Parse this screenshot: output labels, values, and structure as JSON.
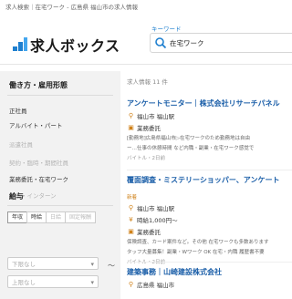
{
  "page_title": "求人検索｜在宅ワーク - 広島県 福山市の求人情報",
  "logo": {
    "text": "求人ボックス"
  },
  "search": {
    "label": "キーワード",
    "value": "在宅ワーク"
  },
  "sidebar": {
    "work_style_title": "働き方・雇用形態",
    "employment_types": [
      {
        "label": "正社員",
        "state": "enabled"
      },
      {
        "label": "アルバイト・パート",
        "state": "enabled"
      },
      {
        "label": "派遣社員",
        "state": "disabled"
      },
      {
        "label": "契約・臨時・期間社員",
        "state": "disabled"
      },
      {
        "label": "業務委託・在宅ワーク",
        "state": "enabled"
      },
      {
        "label": "新卒・インターン",
        "state": "disabled"
      }
    ],
    "pay_title": "給与",
    "pay_tabs": [
      {
        "label": "年収",
        "state": "active"
      },
      {
        "label": "時給",
        "state": "enabled"
      },
      {
        "label": "日給",
        "state": "disabled"
      },
      {
        "label": "固定報酬",
        "state": "disabled"
      }
    ],
    "pay_min_placeholder": "下限なし",
    "pay_max_placeholder": "上限なし",
    "range_separator": "〜"
  },
  "results": {
    "count_text": "求人情報 11 件",
    "jobs": [
      {
        "title": "アンケートモニター｜株式会社リサーチパネル",
        "tag": "",
        "location": "福山市 福山駅",
        "pay": "",
        "type": "業務委託",
        "desc1": "[勤務地]広島県福山市▷在宅ワークのため勤務地は自由",
        "desc2": "ー…仕事の休憩時間 など内職・副業・在宅ワーク感覚で",
        "date": "バイトル・2日前"
      },
      {
        "title": "覆面調査・ミステリーショッパー、アンケート",
        "tag": "新着",
        "location": "福山市 福山駅",
        "pay": "時給1,000円〜",
        "type": "業務委託",
        "desc1": "保険調査、カード案件など。その他 在宅ワークも多数あります",
        "desc2": "タッフ大量募集！副業・Wワーク OK 在宅・内職 履歴書不要",
        "date": "バイトル・2日前"
      },
      {
        "title": "建築事務｜山崎建設株式会社",
        "tag": "",
        "location": "広島県 福山市",
        "pay": "",
        "type": "",
        "desc1": "",
        "desc2": "",
        "date": ""
      }
    ]
  }
}
